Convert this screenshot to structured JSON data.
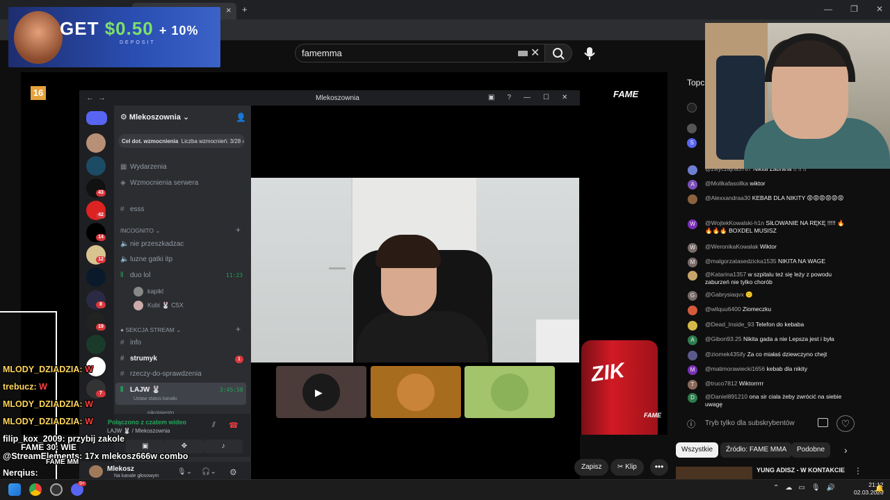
{
  "ad": {
    "headline_get": "GET",
    "headline_amount": "$0.50",
    "headline_bonus": "+ 10%",
    "sub": "DEPOSIT"
  },
  "browser": {
    "new_tab": "+",
    "tab_close": "×"
  },
  "search": {
    "value": "famemma"
  },
  "player": {
    "age_badge": "16",
    "logo": "FAME",
    "logo_small": "FAME",
    "can_text": "ZIK",
    "save_label": "Zapisz",
    "clip_label": "Klip",
    "more": "•••"
  },
  "discord": {
    "window_title": "Mlekoszownia",
    "server_name": "Mlekoszownia",
    "boost_label": "Cel dot. wzmocnienia",
    "boost_count": "Liczba wzmocnień: 3/28",
    "guild_badges": [
      "43",
      "42",
      "14",
      "12",
      "8",
      "19",
      "7"
    ],
    "events": "Wydarzenia",
    "boosts": "Wzmocnienia serwera",
    "channels_top": [
      "esss"
    ],
    "category_incognito": "INCOGNITO",
    "voice_channels": [
      "nie przeszkadzac",
      "luzne gatki itp",
      "duo lol"
    ],
    "duo_time": "11:23",
    "duo_members": [
      "kapikl",
      "Kubi 🐰 C5X"
    ],
    "category_stream": "SEKCJA STREAM",
    "stream_channels": [
      "info",
      "strumyk",
      "rzeczy-do-sprawdzenia"
    ],
    "strumyk_badge": "1",
    "lajw_channel": "LAJW 🐰",
    "lajw_time": "3:45:58",
    "lajw_status": "Ustaw status kanału",
    "lajw_member": "pikolajento",
    "voice_connected": "Połączono z czatem wideo",
    "voice_location": "LAJW 🐰 / Mlekoszownia",
    "user_name": "Mlekosz",
    "user_status": "Na kanale głosowym"
  },
  "chat": {
    "header": "Topc",
    "messages": [
      {
        "name": "@zwyczajna3787",
        "text": "Nikita Zabrana !! !! !!",
        "color": "#6e7fd1"
      },
      {
        "name": "@Mollkafasollka",
        "text": "wiktor",
        "color": "#7b4fb8"
      },
      {
        "name": "@Alexxandraa30",
        "text": "KEBAB DLA NIKITY 😡😡😡😡😡😡",
        "color": "#8a6240"
      },
      {
        "name": "@WojtekKowalski-h1n",
        "text": "SIŁOWANIE NA RĘKĘ !!!!! 🔥🔥🔥🔥 BOXDEL MUSISZ",
        "color": "#7b2fb8"
      },
      {
        "name": "@WeronikaKowalak",
        "text": "Wiktor",
        "color": "#7a6a6a"
      },
      {
        "name": "@malgorzatasedzicka1535",
        "text": "NIKITA NA WAGE",
        "color": "#7a6a6a"
      },
      {
        "name": "@Katarina1357",
        "text": "w szpitalu też się leży z powodu zaburzeń nie tylko chorób",
        "color": "#c9a46a"
      },
      {
        "name": "@Gabrysiaqvx",
        "text": "🙂",
        "color": "#7a6a6a"
      },
      {
        "name": "@wilquu6400",
        "text": "Ziomeczku",
        "color": "#d35a3a"
      },
      {
        "name": "@Dead_Inside_93",
        "text": "Telefon do kebaba",
        "color": "#d4b84a"
      },
      {
        "name": "@Gibon93.25",
        "text": "Nikita gada a nie Lepsza jest i była",
        "color": "#2e7d4f"
      },
      {
        "name": "@ziomek435ify",
        "text": "Za co miałaś dziewczyno chejt",
        "color": "#5a5a8a"
      },
      {
        "name": "@matimorawiecki1656",
        "text": "kebab dla nikity",
        "color": "#7b2fb8"
      },
      {
        "name": "@truco7812",
        "text": "Wiktorrrrr",
        "color": "#8a6a5a"
      },
      {
        "name": "@Daniel891210",
        "text": "ona sir ciala żeby zwrócić na siebie uwagę",
        "color": "#2e7d4f"
      }
    ],
    "avatar_letters": [
      "",
      "A",
      "",
      "W",
      "W",
      "M",
      "",
      "G",
      "",
      "",
      "A",
      "",
      "M",
      "T",
      "D"
    ],
    "input_placeholder": "Tryb tylko dla subskrybentów",
    "info_icon": "ⓘ",
    "heart": "♡"
  },
  "chips": [
    "Wszystkie",
    "Źródło: FAME MMA",
    "Podobne"
  ],
  "chip_arrow": "›",
  "recommended": {
    "title": "YUNG ADISZ - W KONTAKCIE",
    "more": "⋮"
  },
  "overlay": [
    {
      "name": "MLODY_DZIADZIA:",
      "msg": "W",
      "style": "y"
    },
    {
      "name": "trebucz:",
      "msg": "W",
      "style": "y"
    },
    {
      "name": "MLODY_DZIADZIA:",
      "msg": "W",
      "style": "y"
    },
    {
      "name": "MLODY_DZIADZIA:",
      "msg": "W",
      "style": "y"
    },
    {
      "name": "filip_kox_2009:",
      "msg": "przybij zakole",
      "style": "gr"
    },
    {
      "name": "FAME 30: WIE",
      "msg": "",
      "style": "w"
    },
    {
      "name": "@StreamElements:",
      "msg": "17x mlekosz666w combo",
      "style": "gr"
    },
    {
      "name": "FAME MM",
      "msg": "",
      "style": "w"
    },
    {
      "name": "Nerqius:",
      "msg": "",
      "style": "gr"
    }
  ],
  "taskbar": {
    "time": "21:12",
    "date": "02.03.2026",
    "discord_badge": "9+"
  }
}
